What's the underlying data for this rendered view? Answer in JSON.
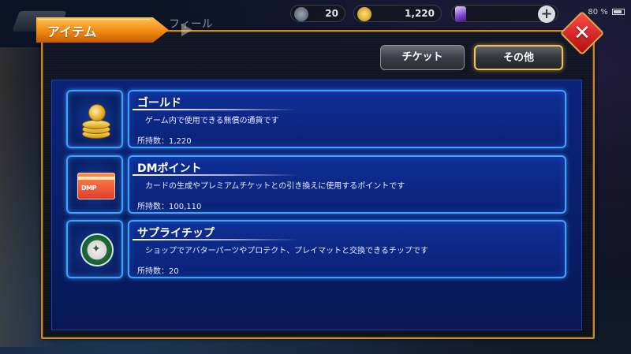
{
  "status_bar": {
    "resource_1": "20",
    "resource_2": "1,220",
    "resource_3": "0",
    "battery": "80 %"
  },
  "background": {
    "hidden_label": "フィール"
  },
  "dialog": {
    "title": "アイテム",
    "close_symbol": "✕",
    "tabs": [
      {
        "label": "チケット",
        "selected": false
      },
      {
        "label": "その他",
        "selected": true
      }
    ],
    "items": [
      {
        "name": "ゴールド",
        "description": "ゲーム内で使用できる無償の通貨です",
        "count": "所持数：1,220",
        "icon": "gold-coins-icon"
      },
      {
        "name": "DMポイント",
        "description": "カードの生成やプレミアムチケットとの引き換えに使用するポイントです",
        "count": "所持数：100,110",
        "icon": "dmp-card-icon",
        "icon_text": "DMP"
      },
      {
        "name": "サプライチップ",
        "description": "ショップでアバターパーツやプロテクト、プレイマットと交換できるチップです",
        "count": "所持数：20",
        "icon": "supply-chip-icon"
      }
    ]
  },
  "colors": {
    "accent_orange": "#f08a10",
    "panel_border": "#c68a27",
    "item_glow": "#3fa2ff",
    "list_bg": "#0c237a",
    "close_red": "#d41515"
  }
}
